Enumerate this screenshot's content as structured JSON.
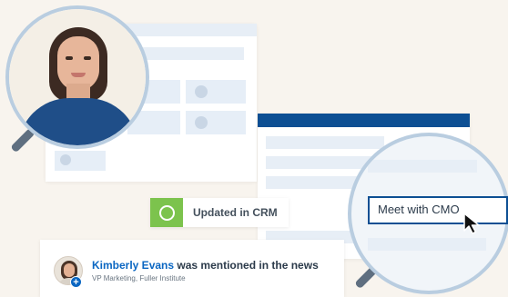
{
  "crm_badge": {
    "label": "Updated in CRM"
  },
  "meeting_input": {
    "value": "Meet with CMO"
  },
  "notification": {
    "person_name": "Kimberly Evans",
    "message": " was mentioned in the news",
    "subtitle": "VP Marketing, Fuller Institute",
    "plus_symbol": "+"
  },
  "colors": {
    "background": "#f8f4ee",
    "header_blue": "#0d4f93",
    "link_blue": "#0a66c2",
    "crm_green": "#7cc34d",
    "lens_border": "#b9cde0"
  },
  "icons": {
    "crm_status": "check-circle-icon",
    "cursor": "mouse-pointer-icon",
    "lens": "magnifier-icon",
    "add": "plus-icon"
  }
}
